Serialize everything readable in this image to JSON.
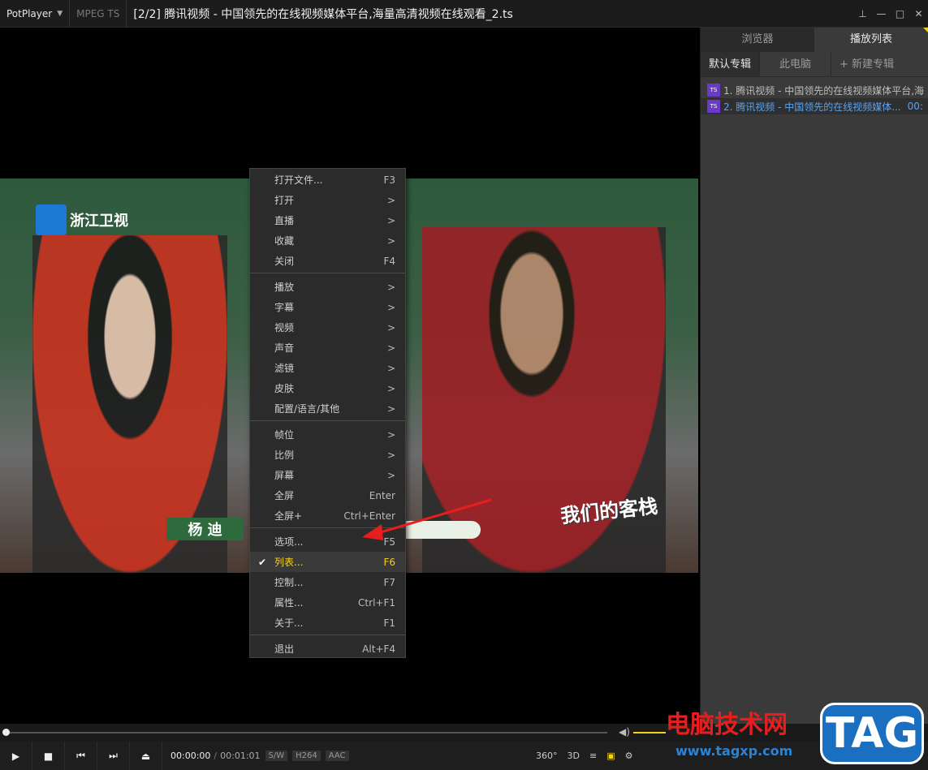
{
  "titlebar": {
    "app_name": "PotPlayer",
    "format": "MPEG TS",
    "title": "[2/2] 腾讯视频 - 中国领先的在线视频媒体平台,海量高清视频在线观看_2.ts"
  },
  "video": {
    "channel": "浙江卫视",
    "name_tag": "杨 迪",
    "show_logo": "我们的客栈"
  },
  "menu": {
    "items": [
      {
        "label": "打开文件...",
        "shortcut": "F3"
      },
      {
        "label": "打开",
        "shortcut": ">"
      },
      {
        "label": "直播",
        "shortcut": ">"
      },
      {
        "label": "收藏",
        "shortcut": ">"
      },
      {
        "label": "关闭",
        "shortcut": "F4"
      },
      {
        "label": "播放",
        "shortcut": ">"
      },
      {
        "label": "字幕",
        "shortcut": ">"
      },
      {
        "label": "视频",
        "shortcut": ">"
      },
      {
        "label": "声音",
        "shortcut": ">"
      },
      {
        "label": "滤镜",
        "shortcut": ">"
      },
      {
        "label": "皮肤",
        "shortcut": ">"
      },
      {
        "label": "配置/语言/其他",
        "shortcut": ">"
      },
      {
        "label": "帧位",
        "shortcut": ">"
      },
      {
        "label": "比例",
        "shortcut": ">"
      },
      {
        "label": "屏幕",
        "shortcut": ">"
      },
      {
        "label": "全屏",
        "shortcut": "Enter"
      },
      {
        "label": "全屏+",
        "shortcut": "Ctrl+Enter"
      },
      {
        "label": "选项...",
        "shortcut": "F5"
      },
      {
        "label": "列表...",
        "shortcut": "F6",
        "checked": true
      },
      {
        "label": "控制...",
        "shortcut": "F7"
      },
      {
        "label": "属性...",
        "shortcut": "Ctrl+F1"
      },
      {
        "label": "关于...",
        "shortcut": "F1"
      },
      {
        "label": "退出",
        "shortcut": "Alt+F4"
      }
    ]
  },
  "panel": {
    "tabs": [
      "浏览器",
      "播放列表"
    ],
    "active_tab": "播放列表",
    "sub_tabs": [
      "默认专辑",
      "此电脑",
      "+ 新建专辑"
    ],
    "playlist": [
      {
        "label": "1. 腾讯视频 - 中国领先的在线视频媒体平台,海",
        "time": ""
      },
      {
        "label": "2. 腾讯视频 - 中国领先的在线视频媒体...",
        "time": "00:",
        "current": true
      }
    ]
  },
  "controls": {
    "time_current": "00:00:00",
    "time_sep": "/",
    "time_total": "00:01:01",
    "badges": [
      "S/W",
      "H264",
      "AAC"
    ],
    "right": [
      "360°",
      "3D"
    ]
  },
  "watermark": {
    "title": "电脑技术网",
    "url": "www.tagxp.com",
    "tag": "TAG"
  },
  "colors": {
    "accent": "#f3d21a",
    "playlist_current": "#5aa3f0",
    "arrow": "#e81e1e"
  }
}
